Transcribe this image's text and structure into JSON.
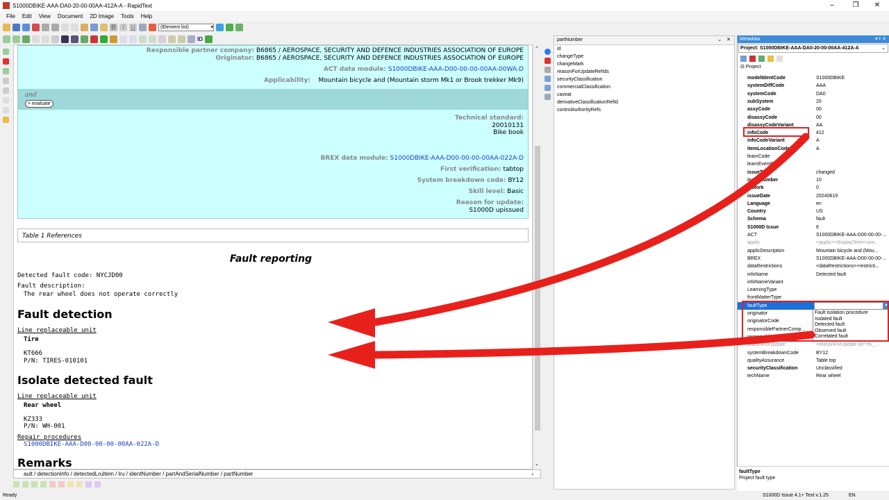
{
  "window": {
    "title": "S1000DBIKE-AAA-DA0-20-00-00AA-412A-A - RapidText",
    "minimize": "–",
    "maximize": "❐",
    "close": "✕"
  },
  "menu": [
    "File",
    "Edit",
    "View",
    "Document",
    "2D Image",
    "Tools",
    "Help"
  ],
  "toolbar": {
    "element_list": "(Element list)",
    "id_label": "ID"
  },
  "ident": {
    "responsible_partner": {
      "label": "Responsible partner company:",
      "value": "B6865 / AEROSPACE, SECURITY AND DEFENCE INDUSTRIES ASSOCIATION OF EUROPE"
    },
    "originator": {
      "label": "Originator:",
      "value": "B6865 / AEROSPACE, SECURITY AND DEFENCE INDUSTRIES ASSOCIATION OF EUROPE"
    },
    "act": {
      "label": "ACT data module:",
      "value": "S1000DBIKE-AAA-D00-00-00-00AA-00WA-D"
    },
    "applicability": {
      "label": "Applicability:",
      "value": "Mountain bicycle and (Mountain storm Mk1 or Brook trekker Mk9)"
    },
    "and_label": "and",
    "evaluate": "+ evaluate",
    "tech_standard": {
      "label": "Technical standard:",
      "line1": "20010131",
      "line2": "Bike book"
    },
    "brex": {
      "label": "BREX data module:",
      "value": "S1000DBIKE-AAA-D00-00-00-00AA-022A-D"
    },
    "first_verification": {
      "label": "First verification:",
      "value": "tabtop"
    },
    "sbc": {
      "label": "System breakdown code:",
      "value": "BY12"
    },
    "skill": {
      "label": "Skill level:",
      "value": "Basic"
    },
    "rfu": {
      "label": "Reason for update:",
      "value": "S1000D upissued"
    }
  },
  "table_caption": "Table 1 References",
  "content": {
    "fault_reporting": "Fault reporting",
    "detected_fault_code": "Detected fault code: NYCJD00",
    "fault_description_label": "Fault description:",
    "fault_description": "The rear wheel does not operate correctly",
    "fault_detection": "Fault detection",
    "lru_label_1": "Line replaceable unit",
    "lru_name_1": "Tire",
    "lru_id_1": "KT666",
    "lru_pn_1": "P/N: TIRES-010101",
    "isolate": "Isolate detected fault",
    "lru_label_2": "Line replaceable unit",
    "lru_name_2": "Rear wheel",
    "lru_id_2": "KZ333",
    "lru_pn_2": "P/N: WH-001",
    "repair_label": "Repair procedures",
    "repair_link": "S1000DBIKE-AAA-D00-00-00-00AA-022A-D",
    "remarks": "Remarks"
  },
  "path_bar": "ault / detectionInfo / detectedLruItem / lru / identNumber / partAndSerialNumber / partNumber",
  "attribute_panel": {
    "header": "partNumber",
    "attributes": [
      "id",
      "changeType",
      "changeMark",
      "reasonForUpdateRefIds",
      "securityClassification",
      "commercialClassification",
      "caveat",
      "derivativeClassificationRefId",
      "controlAuthorityRefs"
    ]
  },
  "metadata": {
    "title": "Metadata",
    "title_controls": "▾ ᵖ ✕",
    "project": "Project: S1000DBIKE-AAA-DA0-20-00-00AA-412A-A",
    "root": "Project",
    "rows": [
      {
        "k": "modelIdentCode",
        "v": "S1000DBIKE",
        "style": "bold"
      },
      {
        "k": "systemDiffCode",
        "v": "AAA",
        "style": "bold"
      },
      {
        "k": "systemCode",
        "v": "DA0",
        "style": "bold"
      },
      {
        "k": "subSystem",
        "v": "20",
        "style": "bold"
      },
      {
        "k": "assyCode",
        "v": "00",
        "style": "bold"
      },
      {
        "k": "disassyCode",
        "v": "00",
        "style": "bold"
      },
      {
        "k": "disassyCodeVariant",
        "v": "AA",
        "style": "bold"
      },
      {
        "k": "infoCode",
        "v": "412",
        "style": "bold"
      },
      {
        "k": "infoCodeVariant",
        "v": "A",
        "style": "bold"
      },
      {
        "k": "itemLocationCode",
        "v": "A",
        "style": "bold"
      },
      {
        "k": "learnCode",
        "v": "",
        "style": ""
      },
      {
        "k": "learnEventCode",
        "v": "",
        "style": ""
      },
      {
        "k": "issueType",
        "v": "changed",
        "style": "bold"
      },
      {
        "k": "issueNumber",
        "v": "10",
        "style": "bold"
      },
      {
        "k": "inWork",
        "v": "0",
        "style": "bold"
      },
      {
        "k": "issueDate",
        "v": "20240619",
        "style": "bold"
      },
      {
        "k": "Language",
        "v": "en",
        "style": "bold"
      },
      {
        "k": "Country",
        "v": "US",
        "style": "bold"
      },
      {
        "k": "Schema",
        "v": "fault",
        "style": "bold"
      },
      {
        "k": "S1000D Issue",
        "v": "6",
        "style": "bold"
      },
      {
        "k": "ACT",
        "v": "S1000DBIKE-AAA-D00-00-00-...",
        "style": ""
      },
      {
        "k": "applic",
        "v": "<applic><displayText><sim...",
        "style": "gray"
      },
      {
        "k": "applicDescription",
        "v": "Mountain bicycle and (Mou...",
        "style": ""
      },
      {
        "k": "BREX",
        "v": "S1000DBIKE-AAA-D00-00-00-...",
        "style": ""
      },
      {
        "k": "dataRestrictions",
        "v": "<dataRestrictions><restricti...",
        "style": ""
      },
      {
        "k": "infoName",
        "v": "Detected fault",
        "style": ""
      },
      {
        "k": "infoNameVariant",
        "v": "",
        "style": ""
      },
      {
        "k": "LearningType",
        "v": "",
        "style": ""
      },
      {
        "k": "frontMatterType",
        "v": "",
        "style": ""
      },
      {
        "k": "faultType",
        "v": "",
        "style": "selected"
      },
      {
        "k": "originator",
        "v": "",
        "style": ""
      },
      {
        "k": "originatorCode",
        "v": "",
        "style": ""
      },
      {
        "k": "responsiblePartnerComp...",
        "v": "",
        "style": ""
      },
      {
        "k": "responsiblePartnerComp...",
        "v": "",
        "style": ""
      },
      {
        "k": "reasonForUpdate",
        "v": "<reasonForUpdate id=\"rfu_...",
        "style": "gray"
      },
      {
        "k": "systemBreakdownCode",
        "v": "BY12",
        "style": ""
      },
      {
        "k": "qualityAssurance",
        "v": "Table top",
        "style": ""
      },
      {
        "k": "securityClassification",
        "v": "Unclassified",
        "style": "bold"
      },
      {
        "k": "techName",
        "v": "Rear wheel",
        "style": ""
      }
    ],
    "dropdown_options": [
      "Fault isolation procedure",
      "Isolated fault",
      "Detected fault",
      "Observed fault",
      "Correlated fault"
    ],
    "desc_title": "faultType",
    "desc_text": "Project fault type"
  },
  "status": {
    "left": "Ready",
    "right": "S1000D Issue 4.1+ Text v.1.25",
    "lang": "EN"
  }
}
